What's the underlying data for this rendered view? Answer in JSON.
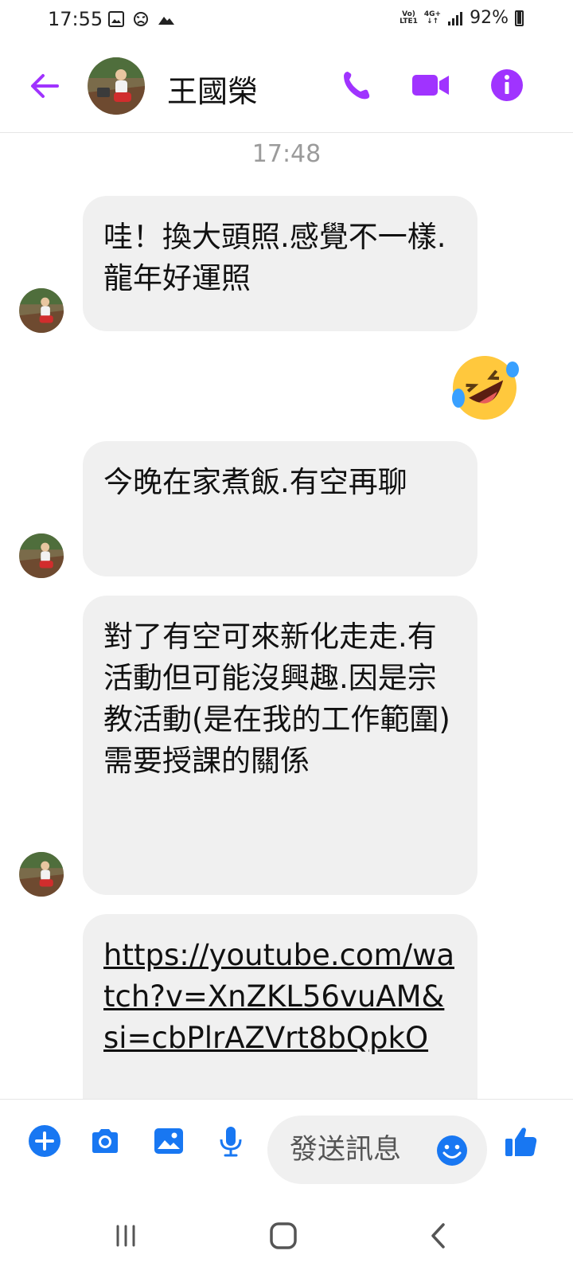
{
  "status_bar": {
    "time": "17:55",
    "network_top": "Vo)",
    "network_bottom": "LTE1",
    "network_type": "4G+",
    "battery": "92%"
  },
  "header": {
    "contact_name": "王國榮",
    "icons": [
      "back-arrow-icon",
      "phone-icon",
      "video-call-icon",
      "info-icon"
    ],
    "accent_color": "#a033ff"
  },
  "chat": {
    "timestamp": "17:48",
    "messages": [
      {
        "text": "哇！換大頭照.感覺不一樣.龍年好運照"
      },
      {
        "text": "今晚在家煮飯.有空再聊"
      },
      {
        "text": "對了有空可來新化走走.有活動但可能沒興趣.因是宗教活動(是在我的工作範圍)需要授課的關係"
      },
      {
        "text": "https://youtube.com/watch?v=XnZKL56vuAM&si=cbPlrAZVrt8bQpkO"
      }
    ],
    "reaction": "rolling-on-floor-laughing-emoji",
    "bubble_color": "#f0f0f0"
  },
  "composer": {
    "placeholder": "發送訊息",
    "icons": [
      "plus-icon",
      "camera-icon",
      "gallery-icon",
      "microphone-icon",
      "emoji-icon",
      "thumbs-up-icon"
    ],
    "accent_color": "#1877f2"
  },
  "navbar": {
    "icons": [
      "recents-icon",
      "home-icon",
      "back-icon"
    ]
  }
}
